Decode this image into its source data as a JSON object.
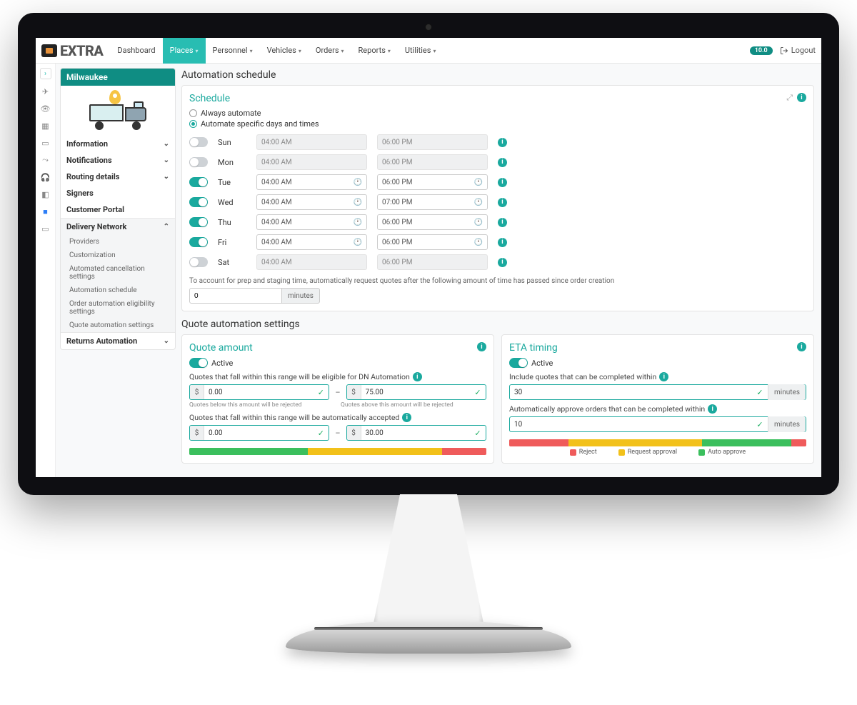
{
  "nav": {
    "brand": "EXTRA",
    "items": [
      "Dashboard",
      "Places",
      "Personnel",
      "Vehicles",
      "Orders",
      "Reports",
      "Utilities"
    ],
    "active_index": 1,
    "version": "10.0",
    "logout": "Logout"
  },
  "rail_icons": [
    "expand",
    "send",
    "eye",
    "building",
    "laptop",
    "chart",
    "headset",
    "bookmark",
    "video",
    "card"
  ],
  "sidebar": {
    "place": "Milwaukee",
    "sections": {
      "information": "Information",
      "notifications": "Notifications",
      "routing": "Routing details",
      "signers": "Signers",
      "customer_portal": "Customer Portal",
      "delivery_network": "Delivery Network",
      "returns": "Returns Automation"
    },
    "dn_items": [
      "Providers",
      "Customization",
      "Automated cancellation settings",
      "Automation schedule",
      "Order automation eligibility settings",
      "Quote automation settings"
    ]
  },
  "page": {
    "title": "Automation schedule",
    "schedule": {
      "title": "Schedule",
      "opt_always": "Always automate",
      "opt_specific": "Automate specific days and times",
      "days": [
        {
          "label": "Sun",
          "on": false,
          "start": "04:00 AM",
          "end": "06:00 PM"
        },
        {
          "label": "Mon",
          "on": false,
          "start": "04:00 AM",
          "end": "06:00 PM"
        },
        {
          "label": "Tue",
          "on": true,
          "start": "04:00 AM",
          "end": "06:00 PM"
        },
        {
          "label": "Wed",
          "on": true,
          "start": "04:00 AM",
          "end": "07:00 PM"
        },
        {
          "label": "Thu",
          "on": true,
          "start": "04:00 AM",
          "end": "06:00 PM"
        },
        {
          "label": "Fri",
          "on": true,
          "start": "04:00 AM",
          "end": "06:00 PM"
        },
        {
          "label": "Sat",
          "on": false,
          "start": "04:00 AM",
          "end": "06:00 PM"
        }
      ],
      "delay_help": "To account for prep and staging time, automatically request quotes after the following amount of time has passed since order creation",
      "delay_value": "0",
      "delay_unit": "minutes"
    },
    "quote_settings_title": "Quote automation settings",
    "quote_amount": {
      "title": "Quote amount",
      "active_label": "Active",
      "range_help": "Quotes that fall within this range will be eligible for DN Automation",
      "min": "0.00",
      "max": "75.00",
      "hint_low": "Quotes below this amount will be rejected",
      "hint_high": "Quotes above this amount will be rejected",
      "accept_help": "Quotes that fall within this range will be automatically accepted",
      "accept_min": "0.00",
      "accept_max": "30.00",
      "currency": "$"
    },
    "eta": {
      "title": "ETA timing",
      "active_label": "Active",
      "include_help": "Include quotes that can be completed within",
      "include_val": "30",
      "approve_help": "Automatically approve orders that can be completed within",
      "approve_val": "10",
      "unit": "minutes",
      "legend_reject": "Reject",
      "legend_request": "Request approval",
      "legend_auto": "Auto approve"
    }
  }
}
